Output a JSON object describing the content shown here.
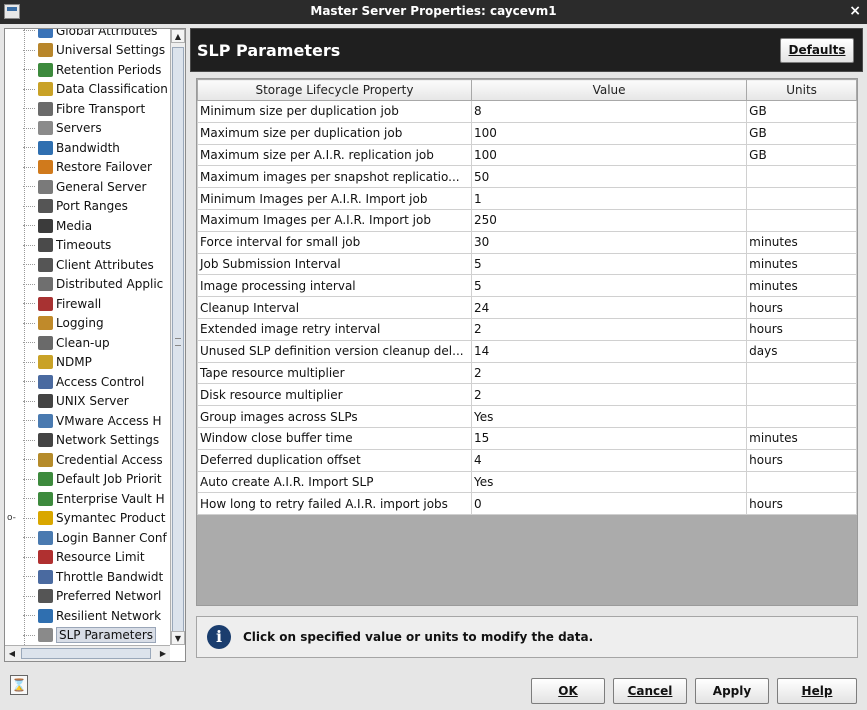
{
  "window": {
    "title": "Master Server Properties: caycevm1",
    "close_glyph": "×"
  },
  "sidebar": {
    "items": [
      {
        "label": "Global Attributes",
        "icon": "globe-icon",
        "color": "#3a73b8"
      },
      {
        "label": "Universal Settings",
        "icon": "settings-icon",
        "color": "#b8862b"
      },
      {
        "label": "Retention Periods",
        "icon": "retention-icon",
        "color": "#3d8a3d"
      },
      {
        "label": "Data Classification",
        "icon": "classification-icon",
        "color": "#c9a227"
      },
      {
        "label": "Fibre Transport",
        "icon": "fibre-icon",
        "color": "#6b6b6b"
      },
      {
        "label": "Servers",
        "icon": "server-icon",
        "color": "#8b8b8b"
      },
      {
        "label": "Bandwidth",
        "icon": "bandwidth-icon",
        "color": "#2f6fb0"
      },
      {
        "label": "Restore Failover",
        "icon": "failover-icon",
        "color": "#d07a1c"
      },
      {
        "label": "General Server",
        "icon": "general-server-icon",
        "color": "#7a7a7a"
      },
      {
        "label": "Port Ranges",
        "icon": "port-icon",
        "color": "#555555"
      },
      {
        "label": "Media",
        "icon": "media-icon",
        "color": "#3b3b3b"
      },
      {
        "label": "Timeouts",
        "icon": "clock-icon",
        "color": "#4a4a4a"
      },
      {
        "label": "Client Attributes",
        "icon": "client-icon",
        "color": "#555555"
      },
      {
        "label": "Distributed Applic",
        "icon": "distributed-icon",
        "color": "#6f6f6f"
      },
      {
        "label": "Firewall",
        "icon": "firewall-icon",
        "color": "#a83232"
      },
      {
        "label": "Logging",
        "icon": "logging-icon",
        "color": "#c08a2a"
      },
      {
        "label": "Clean-up",
        "icon": "cleanup-icon",
        "color": "#6a6a6a"
      },
      {
        "label": "NDMP",
        "icon": "ndmp-icon",
        "color": "#c9a227"
      },
      {
        "label": "Access Control",
        "icon": "access-control-icon",
        "color": "#4a6aa0"
      },
      {
        "label": "UNIX Server",
        "icon": "unix-server-icon",
        "color": "#444444"
      },
      {
        "label": "VMware Access H",
        "icon": "vmware-icon",
        "color": "#4a7ab0"
      },
      {
        "label": "Network Settings",
        "icon": "network-icon",
        "color": "#444444"
      },
      {
        "label": "Credential Access",
        "icon": "credential-icon",
        "color": "#b58b2a"
      },
      {
        "label": "Default Job Priorit",
        "icon": "priority-icon",
        "color": "#3d8a3d"
      },
      {
        "label": "Enterprise Vault H",
        "icon": "vault-icon",
        "color": "#3d8a3d"
      },
      {
        "label": "Symantec Product",
        "icon": "checkmark-icon",
        "color": "#d9a700"
      },
      {
        "label": "Login Banner Conf",
        "icon": "banner-icon",
        "color": "#4a7ab0"
      },
      {
        "label": "Resource Limit",
        "icon": "resource-icon",
        "color": "#b03030"
      },
      {
        "label": "Throttle Bandwidt",
        "icon": "throttle-icon",
        "color": "#4a6aa0"
      },
      {
        "label": "Preferred Networl",
        "icon": "preferred-network-icon",
        "color": "#555555"
      },
      {
        "label": "Resilient Network",
        "icon": "resilient-icon",
        "color": "#2f6fb0"
      },
      {
        "label": "SLP Parameters",
        "icon": "slp-icon",
        "color": "#8a8a8a"
      }
    ],
    "selected": "SLP Parameters",
    "expander_glyph": "o-"
  },
  "panel": {
    "title": "SLP Parameters",
    "defaults_label": "Defaults",
    "columns": [
      "Storage Lifecycle Property",
      "Value",
      "Units"
    ],
    "rows": [
      [
        "Minimum size per duplication job",
        "8",
        "GB"
      ],
      [
        "Maximum size per duplication job",
        "100",
        "GB"
      ],
      [
        "Maximum size per A.I.R. replication job",
        "100",
        "GB"
      ],
      [
        "Maximum images per snapshot replicatio...",
        "50",
        ""
      ],
      [
        "Minimum Images per A.I.R. Import job",
        "1",
        ""
      ],
      [
        "Maximum Images per A.I.R. Import job",
        "250",
        ""
      ],
      [
        "Force interval for small job",
        "30",
        "minutes"
      ],
      [
        "Job Submission Interval",
        "5",
        "minutes"
      ],
      [
        "Image processing interval",
        "5",
        "minutes"
      ],
      [
        "Cleanup Interval",
        "24",
        "hours"
      ],
      [
        "Extended image retry interval",
        "2",
        "hours"
      ],
      [
        "Unused SLP definition version cleanup del...",
        "14",
        "days"
      ],
      [
        "Tape resource multiplier",
        "2",
        ""
      ],
      [
        "Disk resource multiplier",
        "2",
        ""
      ],
      [
        "Group images across SLPs",
        "Yes",
        ""
      ],
      [
        "Window close buffer time",
        "15",
        "minutes"
      ],
      [
        "Deferred duplication offset",
        "4",
        "hours"
      ],
      [
        "Auto create A.I.R. Import SLP",
        "Yes",
        ""
      ],
      [
        "How long to retry failed A.I.R. import jobs",
        "0",
        "hours"
      ]
    ],
    "info_message": "Click on specified value or units to modify the data."
  },
  "footer": {
    "ok": "OK",
    "cancel": "Cancel",
    "apply": "Apply",
    "help": "Help"
  }
}
